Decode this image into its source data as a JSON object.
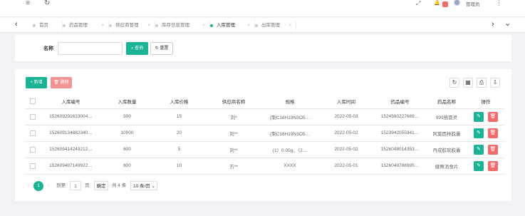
{
  "topbar": {
    "menu_icon": "≡",
    "refresh_icon": "↻",
    "fullscreen_icon": "⤢",
    "bell_icon": "🔔",
    "notification_count": "",
    "username": "管理员",
    "more_icon": "⋮"
  },
  "tabs": {
    "prev_arrow": "‹",
    "next_arrow": "›",
    "dropdown_arrow": "⌄",
    "close_icon": "×",
    "items": [
      {
        "label": "首页"
      },
      {
        "label": "药品管理"
      },
      {
        "label": "供应商管理"
      },
      {
        "label": "库存信息管理"
      },
      {
        "label": "入库管理"
      },
      {
        "label": "出库管理"
      }
    ],
    "active_index": 4
  },
  "search": {
    "label": "名称",
    "value": "",
    "placeholder": "",
    "query_label": "查询",
    "query_icon": "search-icon",
    "reset_label": "重置",
    "reset_icon": "refresh-icon"
  },
  "toolbar": {
    "add_label": "新增",
    "delete_label": "删除"
  },
  "table": {
    "columns": [
      "入库编号",
      "入库数量",
      "入库价格",
      "供应商名称",
      "规格",
      "入库时间",
      "药品编号",
      "药品名称",
      "操作"
    ],
    "rows": [
      {
        "id": "152609291633004…",
        "qty": "500",
        "price": "15",
        "supplier": "刘*",
        "spec": "(制C16H19N3O5…",
        "date": "2022-05-03",
        "drug_id": "1524560227669…",
        "drug_name": "999感冒灵"
      },
      {
        "id": "152609134882340…",
        "qty": "10000",
        "price": "20",
        "supplier": "刘**",
        "spec": "(制C16H19N3O5…",
        "date": "2022-05-02",
        "drug_id": "1523942055941…",
        "drug_name": "阿莫西林胶囊"
      },
      {
        "id": "152609414243212…",
        "qty": "600",
        "price": "5",
        "supplier": "刘**",
        "spec": "(1）0.05g，（2…",
        "date": "2022-05-02",
        "drug_id": "1526048014353…",
        "drug_name": "丹成胶软胶囊"
      },
      {
        "id": "152609497149922…",
        "qty": "600",
        "price": "10",
        "supplier": "方**",
        "spec": "XXXX",
        "date": "2022-05-01",
        "drug_id": "1526049788995…",
        "drug_name": "健胃消食片"
      }
    ]
  },
  "pager": {
    "prev": "‹",
    "current": "1",
    "next": "›",
    "goto_label": "到第",
    "page_value": "1",
    "page_unit": "页",
    "confirm_label": "确定",
    "total_label": "共 4 条",
    "page_size_label": "10 条/页"
  },
  "colors": {
    "primary": "#1ab394",
    "danger": "#f26c6c",
    "danger_light": "#f29494"
  }
}
